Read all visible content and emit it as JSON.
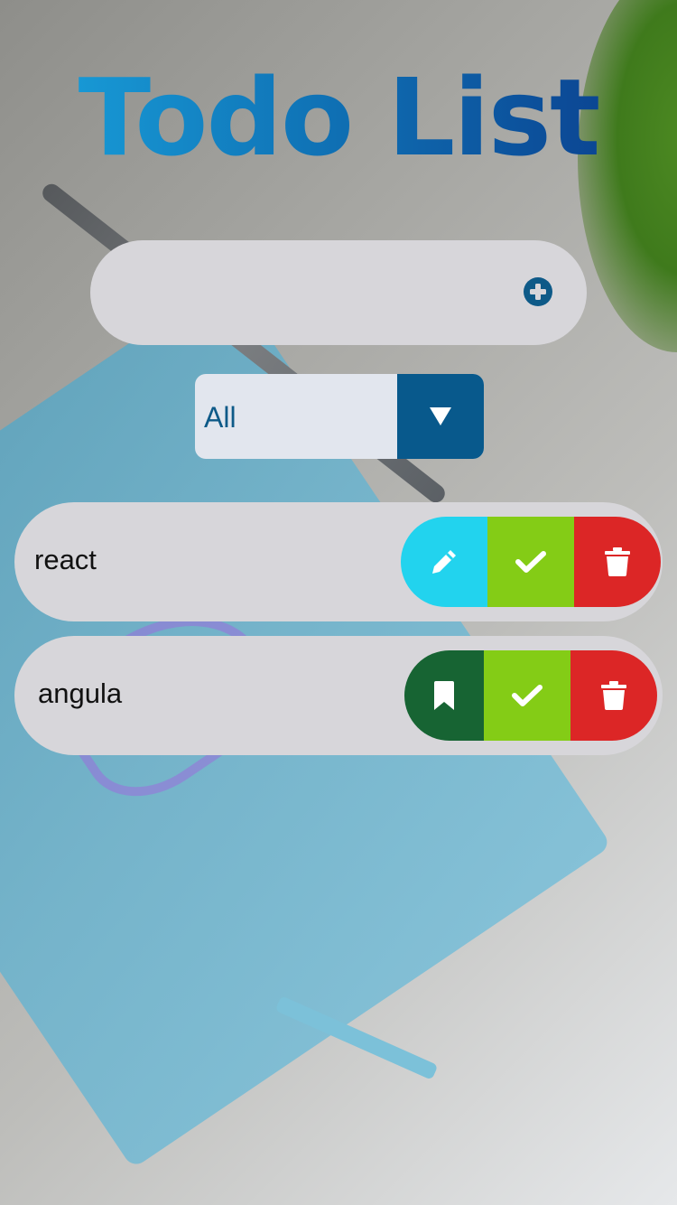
{
  "app": {
    "title": "Todo List"
  },
  "add_form": {
    "input_value": "",
    "button_icon": "plus-circle-icon"
  },
  "filter": {
    "selected": "All",
    "arrow_icon": "caret-down-icon"
  },
  "todos": [
    {
      "text": "react",
      "first_action": "edit",
      "first_icon": "pencil-icon",
      "complete_icon": "check-icon",
      "delete_icon": "trash-icon"
    },
    {
      "text": "angula",
      "first_action": "bookmark",
      "first_icon": "bookmark-icon",
      "complete_icon": "check-icon",
      "delete_icon": "trash-icon"
    }
  ],
  "colors": {
    "title_gradient": [
      "#1aa4de",
      "#0a3a8a"
    ],
    "card_bg": "#d7d6da",
    "filter_accent": "#08598c",
    "edit": "#22d3ee",
    "bookmark": "#176433",
    "complete": "#84cc16",
    "delete": "#dc2626"
  }
}
